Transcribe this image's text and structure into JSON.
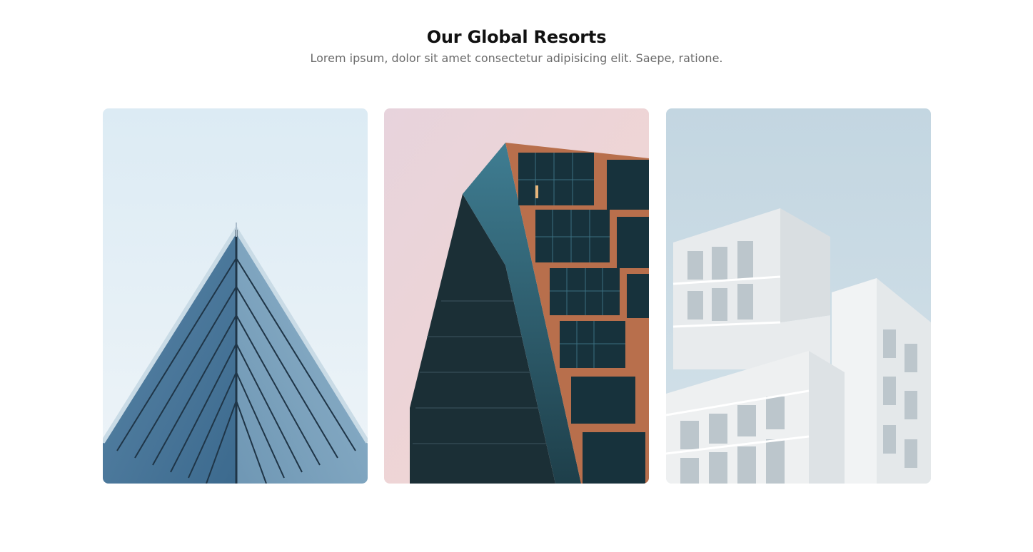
{
  "section": {
    "title": "Our Global Resorts",
    "subtitle": "Lorem ipsum, dolor sit amet consectetur adipisicing elit. Saepe, ratione."
  },
  "cards": [
    {
      "image": "glass-pyramid-building"
    },
    {
      "image": "copper-glass-tower"
    },
    {
      "image": "white-stacked-building"
    }
  ]
}
